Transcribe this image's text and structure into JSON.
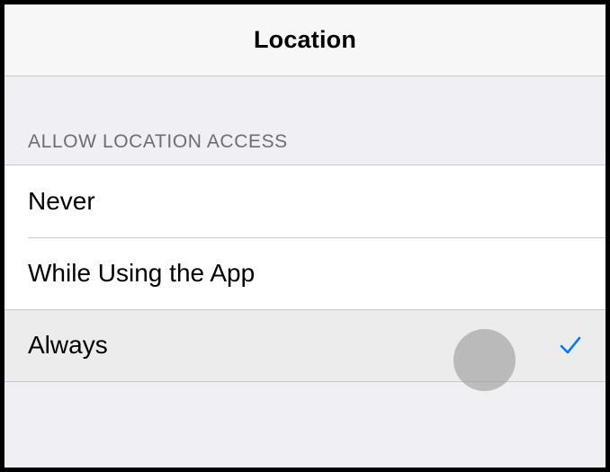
{
  "nav": {
    "title": "Location"
  },
  "section": {
    "header": "ALLOW LOCATION ACCESS"
  },
  "options": [
    {
      "label": "Never",
      "selected": false
    },
    {
      "label": "While Using the App",
      "selected": false
    },
    {
      "label": "Always",
      "selected": true
    }
  ],
  "colors": {
    "accent": "#007aff",
    "background": "#efeff4",
    "separator": "#c8c7cc",
    "section_text": "#6d6d72"
  },
  "icons": {
    "selected": "checkmark-icon"
  }
}
